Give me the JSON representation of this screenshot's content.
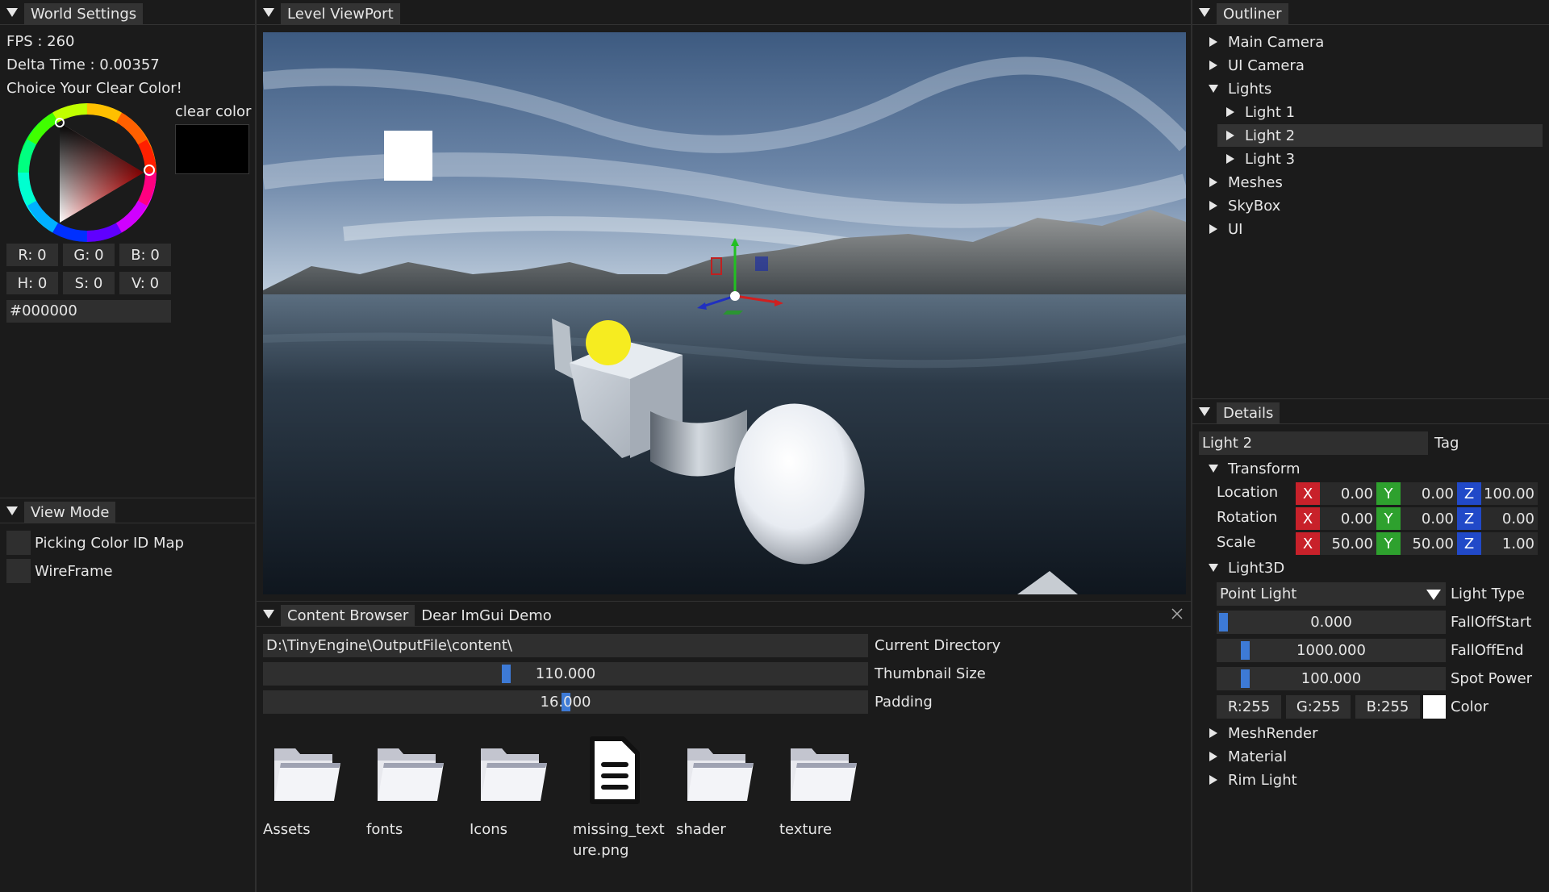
{
  "world_settings": {
    "title": "World Settings",
    "fps": "FPS : 260",
    "delta": "Delta Time : 0.00357",
    "choice": "Choice Your Clear Color!",
    "clear_color_label": "clear color",
    "clear_color_value": "#000000",
    "r": "R:  0",
    "g": "G:  0",
    "b": "B:  0",
    "h": "H:  0",
    "s": "S:  0",
    "v": "V:  0",
    "hex": "#000000"
  },
  "view_mode": {
    "title": "View Mode",
    "options": [
      "Picking Color ID Map",
      "WireFrame"
    ]
  },
  "viewport": {
    "title": "Level ViewPort"
  },
  "outliner": {
    "title": "Outliner",
    "items": [
      {
        "label": "Main Camera",
        "expanded": false,
        "depth": 0
      },
      {
        "label": "UI Camera",
        "expanded": false,
        "depth": 0
      },
      {
        "label": "Lights",
        "expanded": true,
        "depth": 0
      },
      {
        "label": "Light 1",
        "expanded": false,
        "depth": 1
      },
      {
        "label": "Light 2",
        "expanded": false,
        "depth": 1,
        "selected": true
      },
      {
        "label": "Light 3",
        "expanded": false,
        "depth": 1
      },
      {
        "label": "Meshes",
        "expanded": false,
        "depth": 0
      },
      {
        "label": "SkyBox",
        "expanded": false,
        "depth": 0
      },
      {
        "label": "UI",
        "expanded": false,
        "depth": 0
      }
    ]
  },
  "details": {
    "title": "Details",
    "name": "Light 2",
    "tag_label": "Tag",
    "transform": {
      "label": "Transform",
      "rows": [
        {
          "label": "Location",
          "x": "0.00",
          "y": "0.00",
          "z": "100.00"
        },
        {
          "label": "Rotation",
          "x": "0.00",
          "y": "0.00",
          "z": "0.00"
        },
        {
          "label": "Scale",
          "x": "50.00",
          "y": "50.00",
          "z": "1.00"
        }
      ],
      "axis_x": "X",
      "axis_y": "Y",
      "axis_z": "Z"
    },
    "light3d": {
      "label": "Light3D",
      "light_type": "Point Light",
      "light_type_label": "Light Type",
      "falloff_start": "0.000",
      "falloff_start_label": "FallOffStart",
      "falloff_start_level": 0.0,
      "falloff_end": "1000.000",
      "falloff_end_label": "FallOffEnd",
      "falloff_end_level": 0.1,
      "spot_power": "100.000",
      "spot_power_label": "Spot Power",
      "spot_power_level": 0.1,
      "r": "R:255",
      "g": "G:255",
      "b": "B:255",
      "color_label": "Color",
      "color_value": "#ffffff"
    },
    "sections": [
      "MeshRender",
      "Material",
      "Rim Light"
    ]
  },
  "content_browser": {
    "tabs": [
      "Content Browser",
      "Dear ImGui Demo"
    ],
    "directory": "D:\\TinyEngine\\OutputFile\\content\\",
    "directory_label": "Current Directory",
    "thumbnail_size": "110.000",
    "thumbnail_label": "Thumbnail Size",
    "thumbnail_level": 0.4,
    "padding": "16.000",
    "padding_label": "Padding",
    "padding_level": 0.5,
    "items": [
      {
        "label": "Assets",
        "icon": "folder-icon"
      },
      {
        "label": "fonts",
        "icon": "folder-icon"
      },
      {
        "label": "Icons",
        "icon": "folder-icon"
      },
      {
        "label": "missing_texture.png",
        "icon": "file-icon"
      },
      {
        "label": "shader",
        "icon": "folder-icon"
      },
      {
        "label": "texture",
        "icon": "folder-icon"
      }
    ]
  },
  "colors": {
    "accent": "#3d7ad6",
    "axis_x": "#c8212a",
    "axis_y": "#2ea12e",
    "axis_z": "#2149c8",
    "selection": "#333333"
  }
}
